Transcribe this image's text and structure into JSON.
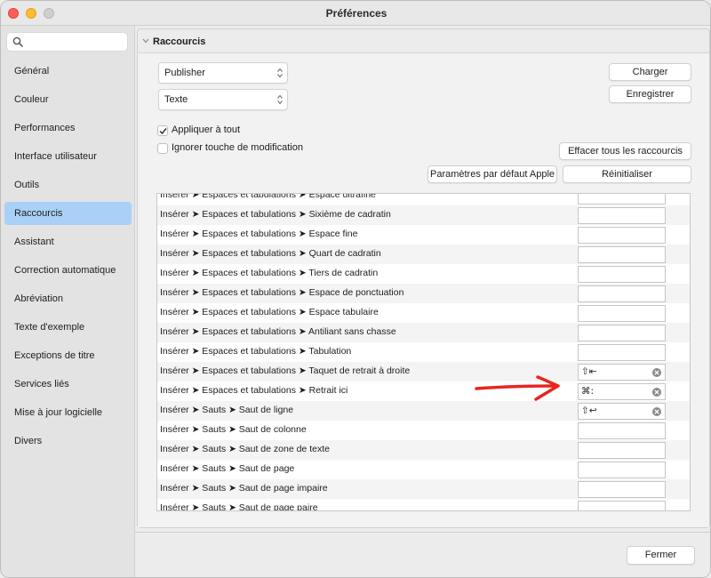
{
  "window": {
    "title": "Préférences"
  },
  "sidebar": {
    "search_placeholder": "",
    "items": [
      {
        "label": "Général"
      },
      {
        "label": "Couleur"
      },
      {
        "label": "Performances"
      },
      {
        "label": "Interface utilisateur"
      },
      {
        "label": "Outils"
      },
      {
        "label": "Raccourcis",
        "active": true
      },
      {
        "label": "Assistant"
      },
      {
        "label": "Correction automatique"
      },
      {
        "label": "Abréviation"
      },
      {
        "label": "Texte d'exemple"
      },
      {
        "label": "Exceptions de titre"
      },
      {
        "label": "Services liés"
      },
      {
        "label": "Mise à jour logicielle"
      },
      {
        "label": "Divers"
      }
    ]
  },
  "section": {
    "title": "Raccourcis"
  },
  "controls": {
    "app_popup": "Publisher",
    "category_popup": "Texte",
    "load_button": "Charger",
    "save_button": "Enregistrer",
    "apply_all_label": "Appliquer à tout",
    "apply_all_checked": true,
    "ignore_modifier_label": "Ignorer touche de modification",
    "ignore_modifier_checked": false,
    "clear_all_button": "Effacer tous les raccourcis",
    "apple_defaults_button": "Paramètres par défaut Apple",
    "reset_button": "Réinitialiser"
  },
  "shortcuts": [
    {
      "path": "Insérer  ➤ Espaces et tabulations ➤ Espace ultrafine",
      "key": ""
    },
    {
      "path": "Insérer  ➤ Espaces et tabulations ➤ Sixième de cadratin",
      "key": ""
    },
    {
      "path": "Insérer  ➤ Espaces et tabulations ➤ Espace fine",
      "key": ""
    },
    {
      "path": "Insérer  ➤ Espaces et tabulations ➤ Quart de cadratin",
      "key": ""
    },
    {
      "path": "Insérer  ➤ Espaces et tabulations ➤ Tiers de cadratin",
      "key": ""
    },
    {
      "path": "Insérer  ➤ Espaces et tabulations ➤ Espace de ponctuation",
      "key": ""
    },
    {
      "path": "Insérer  ➤ Espaces et tabulations ➤ Espace tabulaire",
      "key": ""
    },
    {
      "path": "Insérer  ➤ Espaces et tabulations ➤ Antiliant sans chasse",
      "key": ""
    },
    {
      "path": "Insérer  ➤ Espaces et tabulations ➤ Tabulation",
      "key": ""
    },
    {
      "path": "Insérer  ➤ Espaces et tabulations ➤ Taquet de retrait à droite",
      "key": "⇧⇤"
    },
    {
      "path": "Insérer  ➤ Espaces et tabulations ➤ Retrait ici",
      "key": "⌘:"
    },
    {
      "path": "Insérer  ➤ Sauts ➤ Saut de ligne",
      "key": "⇧↩"
    },
    {
      "path": "Insérer  ➤ Sauts ➤ Saut de colonne",
      "key": ""
    },
    {
      "path": "Insérer  ➤ Sauts ➤ Saut de zone de texte",
      "key": ""
    },
    {
      "path": "Insérer  ➤ Sauts ➤ Saut de page",
      "key": ""
    },
    {
      "path": "Insérer  ➤ Sauts ➤ Saut de page impaire",
      "key": ""
    },
    {
      "path": "Insérer  ➤ Sauts ➤ Saut de page paire",
      "key": ""
    }
  ],
  "footer": {
    "close_button": "Fermer"
  },
  "colors": {
    "selection": "#a9d1f7",
    "annotation_arrow": "#e8251f"
  }
}
